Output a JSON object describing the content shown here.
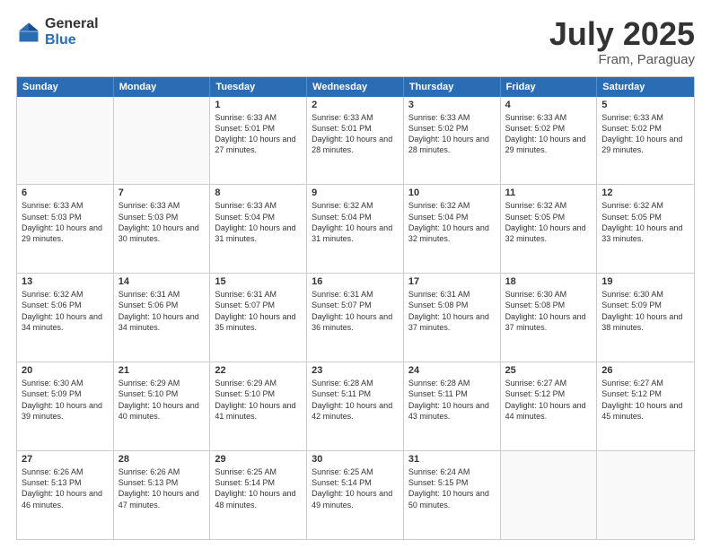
{
  "logo": {
    "general": "General",
    "blue": "Blue"
  },
  "title": "July 2025",
  "location": "Fram, Paraguay",
  "header_days": [
    "Sunday",
    "Monday",
    "Tuesday",
    "Wednesday",
    "Thursday",
    "Friday",
    "Saturday"
  ],
  "weeks": [
    [
      {
        "day": "",
        "empty": true
      },
      {
        "day": "",
        "empty": true
      },
      {
        "day": "1",
        "sunrise": "6:33 AM",
        "sunset": "5:01 PM",
        "daylight": "10 hours and 27 minutes."
      },
      {
        "day": "2",
        "sunrise": "6:33 AM",
        "sunset": "5:01 PM",
        "daylight": "10 hours and 28 minutes."
      },
      {
        "day": "3",
        "sunrise": "6:33 AM",
        "sunset": "5:02 PM",
        "daylight": "10 hours and 28 minutes."
      },
      {
        "day": "4",
        "sunrise": "6:33 AM",
        "sunset": "5:02 PM",
        "daylight": "10 hours and 29 minutes."
      },
      {
        "day": "5",
        "sunrise": "6:33 AM",
        "sunset": "5:02 PM",
        "daylight": "10 hours and 29 minutes."
      }
    ],
    [
      {
        "day": "6",
        "sunrise": "6:33 AM",
        "sunset": "5:03 PM",
        "daylight": "10 hours and 29 minutes."
      },
      {
        "day": "7",
        "sunrise": "6:33 AM",
        "sunset": "5:03 PM",
        "daylight": "10 hours and 30 minutes."
      },
      {
        "day": "8",
        "sunrise": "6:33 AM",
        "sunset": "5:04 PM",
        "daylight": "10 hours and 31 minutes."
      },
      {
        "day": "9",
        "sunrise": "6:32 AM",
        "sunset": "5:04 PM",
        "daylight": "10 hours and 31 minutes."
      },
      {
        "day": "10",
        "sunrise": "6:32 AM",
        "sunset": "5:04 PM",
        "daylight": "10 hours and 32 minutes."
      },
      {
        "day": "11",
        "sunrise": "6:32 AM",
        "sunset": "5:05 PM",
        "daylight": "10 hours and 32 minutes."
      },
      {
        "day": "12",
        "sunrise": "6:32 AM",
        "sunset": "5:05 PM",
        "daylight": "10 hours and 33 minutes."
      }
    ],
    [
      {
        "day": "13",
        "sunrise": "6:32 AM",
        "sunset": "5:06 PM",
        "daylight": "10 hours and 34 minutes."
      },
      {
        "day": "14",
        "sunrise": "6:31 AM",
        "sunset": "5:06 PM",
        "daylight": "10 hours and 34 minutes."
      },
      {
        "day": "15",
        "sunrise": "6:31 AM",
        "sunset": "5:07 PM",
        "daylight": "10 hours and 35 minutes."
      },
      {
        "day": "16",
        "sunrise": "6:31 AM",
        "sunset": "5:07 PM",
        "daylight": "10 hours and 36 minutes."
      },
      {
        "day": "17",
        "sunrise": "6:31 AM",
        "sunset": "5:08 PM",
        "daylight": "10 hours and 37 minutes."
      },
      {
        "day": "18",
        "sunrise": "6:30 AM",
        "sunset": "5:08 PM",
        "daylight": "10 hours and 37 minutes."
      },
      {
        "day": "19",
        "sunrise": "6:30 AM",
        "sunset": "5:09 PM",
        "daylight": "10 hours and 38 minutes."
      }
    ],
    [
      {
        "day": "20",
        "sunrise": "6:30 AM",
        "sunset": "5:09 PM",
        "daylight": "10 hours and 39 minutes."
      },
      {
        "day": "21",
        "sunrise": "6:29 AM",
        "sunset": "5:10 PM",
        "daylight": "10 hours and 40 minutes."
      },
      {
        "day": "22",
        "sunrise": "6:29 AM",
        "sunset": "5:10 PM",
        "daylight": "10 hours and 41 minutes."
      },
      {
        "day": "23",
        "sunrise": "6:28 AM",
        "sunset": "5:11 PM",
        "daylight": "10 hours and 42 minutes."
      },
      {
        "day": "24",
        "sunrise": "6:28 AM",
        "sunset": "5:11 PM",
        "daylight": "10 hours and 43 minutes."
      },
      {
        "day": "25",
        "sunrise": "6:27 AM",
        "sunset": "5:12 PM",
        "daylight": "10 hours and 44 minutes."
      },
      {
        "day": "26",
        "sunrise": "6:27 AM",
        "sunset": "5:12 PM",
        "daylight": "10 hours and 45 minutes."
      }
    ],
    [
      {
        "day": "27",
        "sunrise": "6:26 AM",
        "sunset": "5:13 PM",
        "daylight": "10 hours and 46 minutes."
      },
      {
        "day": "28",
        "sunrise": "6:26 AM",
        "sunset": "5:13 PM",
        "daylight": "10 hours and 47 minutes."
      },
      {
        "day": "29",
        "sunrise": "6:25 AM",
        "sunset": "5:14 PM",
        "daylight": "10 hours and 48 minutes."
      },
      {
        "day": "30",
        "sunrise": "6:25 AM",
        "sunset": "5:14 PM",
        "daylight": "10 hours and 49 minutes."
      },
      {
        "day": "31",
        "sunrise": "6:24 AM",
        "sunset": "5:15 PM",
        "daylight": "10 hours and 50 minutes."
      },
      {
        "day": "",
        "empty": true
      },
      {
        "day": "",
        "empty": true
      }
    ]
  ]
}
